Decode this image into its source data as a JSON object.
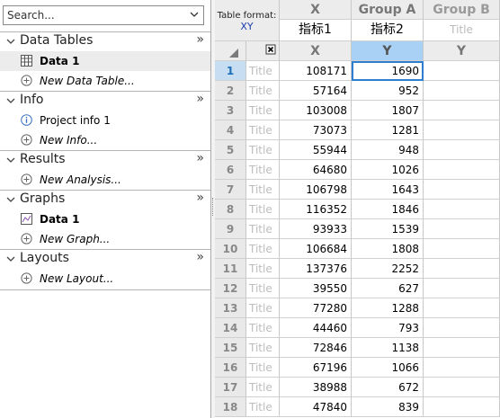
{
  "navigator": {
    "search_placeholder": "Search...",
    "sections": [
      {
        "title": "Data Tables",
        "items": [
          {
            "label": "Data 1",
            "icon": "data-table-icon"
          },
          {
            "label": "New Data Table...",
            "icon": "plus-circle-icon"
          }
        ]
      },
      {
        "title": "Info",
        "items": [
          {
            "label": "Project info 1",
            "icon": "info-icon"
          },
          {
            "label": "New Info...",
            "icon": "plus-circle-icon"
          }
        ]
      },
      {
        "title": "Results",
        "items": [
          {
            "label": "New Analysis...",
            "icon": "plus-circle-icon"
          }
        ]
      },
      {
        "title": "Graphs",
        "items": [
          {
            "label": "Data 1",
            "icon": "graph-icon"
          },
          {
            "label": "New Graph...",
            "icon": "plus-circle-icon"
          }
        ]
      },
      {
        "title": "Layouts",
        "items": [
          {
            "label": "New Layout...",
            "icon": "plus-circle-icon"
          }
        ]
      }
    ],
    "expand_glyph": "»"
  },
  "table": {
    "format_label": "Table format:",
    "format_value": "XY",
    "columns": {
      "x": {
        "group": "X",
        "title": "指标1",
        "sub": "X"
      },
      "group_a": {
        "group": "Group A",
        "title": "指标2",
        "sub": "Y"
      },
      "group_b": {
        "group": "Group B",
        "title_placeholder": "Title",
        "sub": "Y"
      }
    },
    "row_title_placeholder": "Title",
    "rows": [
      {
        "n": "1",
        "x": "108171",
        "y": "1690"
      },
      {
        "n": "2",
        "x": "57164",
        "y": "952"
      },
      {
        "n": "3",
        "x": "103008",
        "y": "1807"
      },
      {
        "n": "4",
        "x": "73073",
        "y": "1281"
      },
      {
        "n": "5",
        "x": "55944",
        "y": "948"
      },
      {
        "n": "6",
        "x": "64680",
        "y": "1026"
      },
      {
        "n": "7",
        "x": "106798",
        "y": "1643"
      },
      {
        "n": "8",
        "x": "116352",
        "y": "1846"
      },
      {
        "n": "9",
        "x": "93933",
        "y": "1539"
      },
      {
        "n": "10",
        "x": "106684",
        "y": "1808"
      },
      {
        "n": "11",
        "x": "137376",
        "y": "2252"
      },
      {
        "n": "12",
        "x": "39550",
        "y": "627"
      },
      {
        "n": "13",
        "x": "77280",
        "y": "1288"
      },
      {
        "n": "14",
        "x": "44460",
        "y": "793"
      },
      {
        "n": "15",
        "x": "72846",
        "y": "1138"
      },
      {
        "n": "16",
        "x": "67196",
        "y": "1066"
      },
      {
        "n": "17",
        "x": "38988",
        "y": "672"
      },
      {
        "n": "18",
        "x": "47840",
        "y": "839"
      }
    ]
  },
  "colors": {
    "selection_blue": "#a9d1f5",
    "selection_border": "#2f7fd0",
    "format_blue": "#1a3fb0"
  }
}
